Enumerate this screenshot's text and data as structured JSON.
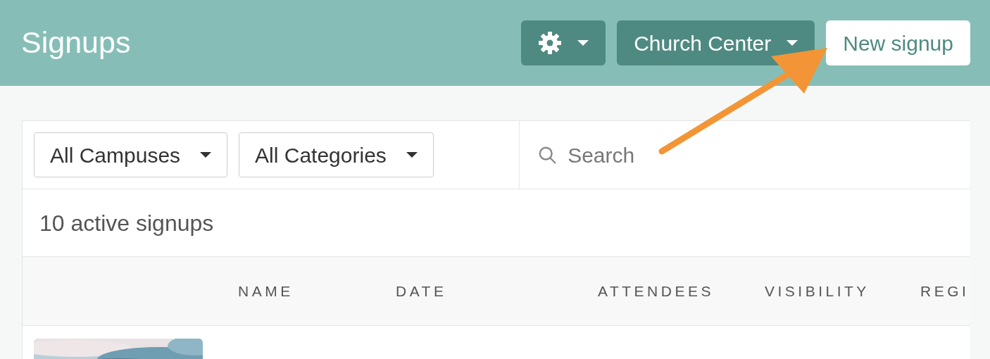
{
  "header": {
    "title": "Signups",
    "buttons": [
      {
        "kind": "settings-menu"
      },
      {
        "kind": "menu",
        "label": "Church Center"
      },
      {
        "kind": "primary",
        "label": "New signup"
      }
    ]
  },
  "filters": [
    {
      "label": "All Campuses"
    },
    {
      "label": "All Categories"
    }
  ],
  "search": {
    "placeholder": "Search"
  },
  "count": "10 active signups",
  "table": {
    "columns": [
      "NAME",
      "DATE",
      "ATTENDEES",
      "VISIBILITY",
      "REGI"
    ]
  },
  "annotation": {
    "kind": "arrow"
  }
}
